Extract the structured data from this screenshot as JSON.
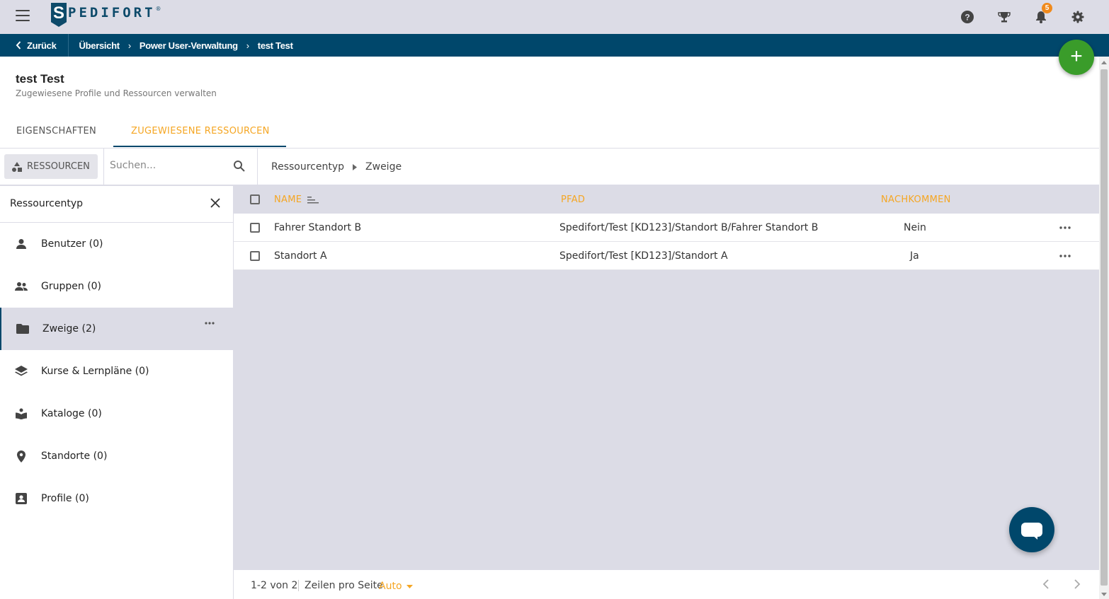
{
  "brand": {
    "logo_initial": "S",
    "logo_rest": "PEDIFORT",
    "logo_reg": "®"
  },
  "topbar": {
    "notification_count": "5"
  },
  "breadcrumb": {
    "back_label": "Zurück",
    "items": [
      "Übersicht",
      "Power User-Verwaltung",
      "test Test"
    ],
    "separator": "›"
  },
  "page": {
    "title": "test Test",
    "subtitle": "Zugewiesene Profile und Ressourcen verwalten",
    "tabs": [
      {
        "label": "Eigenschaften",
        "active": false
      },
      {
        "label": "Zugewiesene Ressourcen",
        "active": true
      }
    ]
  },
  "toolbar": {
    "resources_label": "Ressourcen",
    "search_placeholder": "Suchen...",
    "path": [
      "Ressourcentyp",
      "Zweige"
    ]
  },
  "sidebar": {
    "header": "Ressourcentyp",
    "items": [
      {
        "label": "Benutzer (0)",
        "icon": "person-icon",
        "active": false
      },
      {
        "label": "Gruppen (0)",
        "icon": "group-icon",
        "active": false
      },
      {
        "label": "Zweige (2)",
        "icon": "folder-icon",
        "active": true
      },
      {
        "label": "Kurse & Lernpläne (0)",
        "icon": "layers-icon",
        "active": false
      },
      {
        "label": "Kataloge (0)",
        "icon": "book-icon",
        "active": false
      },
      {
        "label": "Standorte (0)",
        "icon": "location-pin-icon",
        "active": false
      },
      {
        "label": "Profile (0)",
        "icon": "profile-card-icon",
        "active": false
      }
    ]
  },
  "table": {
    "columns": [
      "Name",
      "Pfad",
      "Nachkommen"
    ],
    "rows": [
      {
        "name": "Fahrer Standort B",
        "path": "Spedifort/Test [KD123]/Standort B/Fahrer Standort B",
        "descendants": "Nein"
      },
      {
        "name": "Standort A",
        "path": "Spedifort/Test [KD123]/Standort A",
        "descendants": "Ja"
      }
    ]
  },
  "footer": {
    "range": "1-2 von 2",
    "rows_per_page_label": "Zeilen pro Seite",
    "rows_per_page_value": "Auto"
  },
  "colors": {
    "primary": "#00476b",
    "accent": "#f5a623",
    "success": "#3a9c2a",
    "badge": "#f08a1c"
  }
}
